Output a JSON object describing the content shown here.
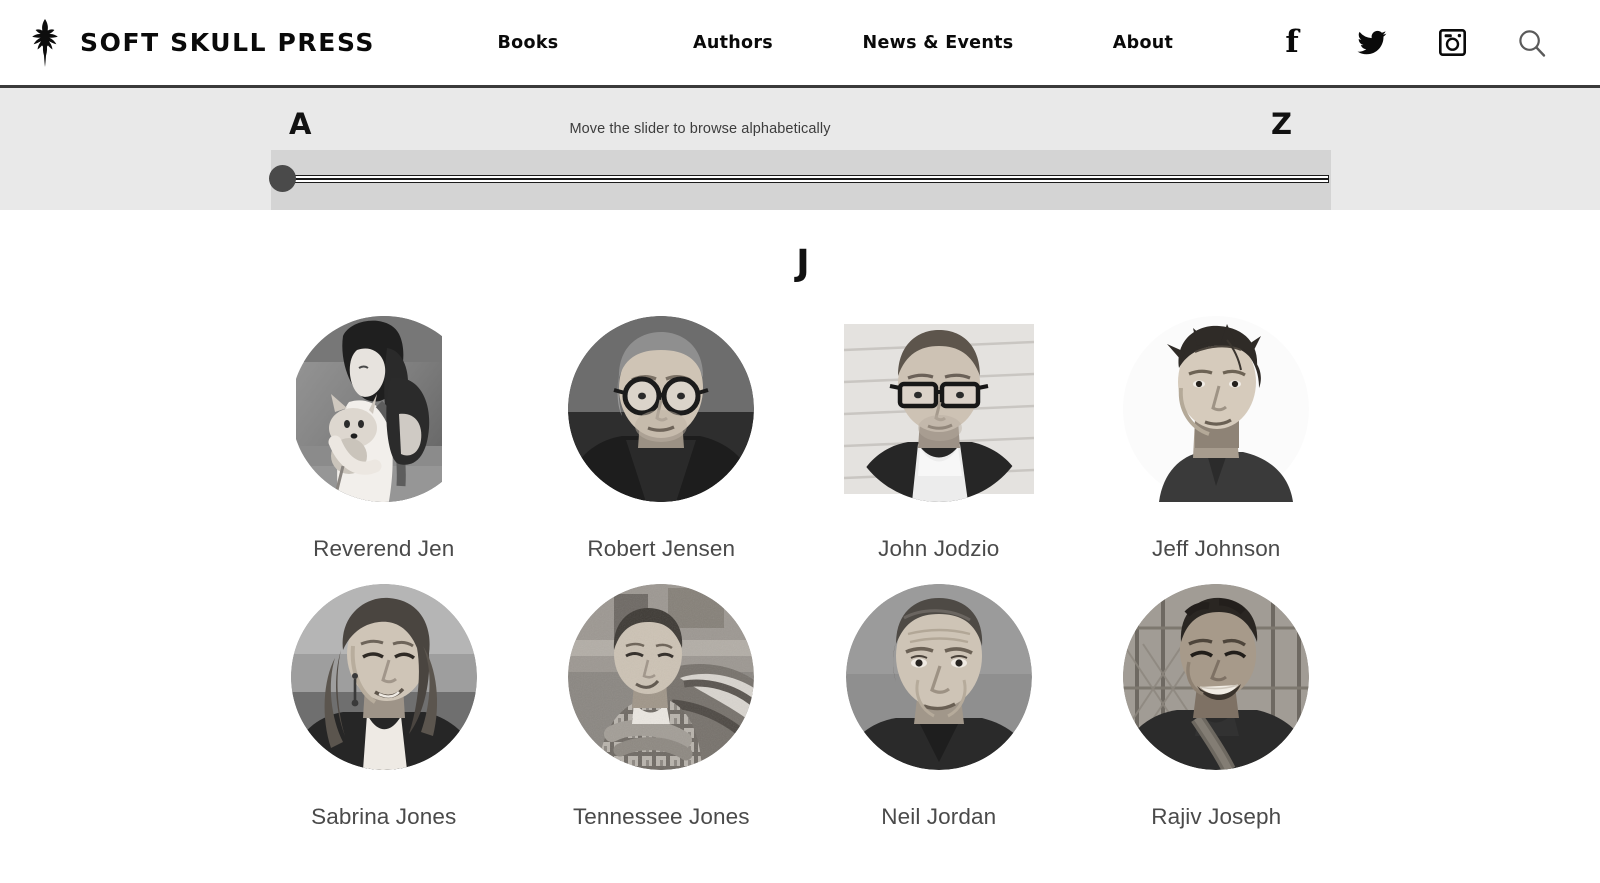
{
  "header": {
    "logo_icon": "beetle-logo-icon",
    "brand": "SOFT SKULL PRESS",
    "nav": [
      {
        "label": "Books",
        "name": "nav-books"
      },
      {
        "label": "Authors",
        "name": "nav-authors"
      },
      {
        "label": "News & Events",
        "name": "nav-news-events"
      },
      {
        "label": "About",
        "name": "nav-about"
      }
    ],
    "social": [
      {
        "icon": "facebook-icon",
        "glyph": "f",
        "label": "Facebook"
      },
      {
        "icon": "twitter-icon",
        "glyph": "",
        "label": "Twitter"
      },
      {
        "icon": "instagram-icon",
        "glyph": "",
        "label": "Instagram"
      },
      {
        "icon": "search-icon",
        "glyph": "",
        "label": "Search"
      }
    ]
  },
  "alpha_slider": {
    "start_letter": "A",
    "end_letter": "Z",
    "hint": "Move the slider to browse alphabetically",
    "handle_position_percent": 0,
    "track_color": "#1b1b1b",
    "handle_color": "#4a4a4a",
    "strip_background": "#e9e9e9",
    "rail_background": "#d4d4d4"
  },
  "authors_section": {
    "current_letter": "J",
    "authors": [
      {
        "name": "Reverend Jen",
        "portrait": "portrait-reverend-jen"
      },
      {
        "name": "Robert Jensen",
        "portrait": "portrait-robert-jensen"
      },
      {
        "name": "John Jodzio",
        "portrait": "portrait-john-jodzio"
      },
      {
        "name": "Jeff Johnson",
        "portrait": "portrait-jeff-johnson"
      },
      {
        "name": "Sabrina Jones",
        "portrait": "portrait-sabrina-jones"
      },
      {
        "name": "Tennessee Jones",
        "portrait": "portrait-tennessee-jones"
      },
      {
        "name": "Neil Jordan",
        "portrait": "portrait-neil-jordan"
      },
      {
        "name": "Rajiv Joseph",
        "portrait": "portrait-rajiv-joseph"
      }
    ]
  },
  "colors": {
    "text_dark": "#111111",
    "name_gray": "#4a4a4a",
    "header_rule": "#3a3a3a"
  }
}
